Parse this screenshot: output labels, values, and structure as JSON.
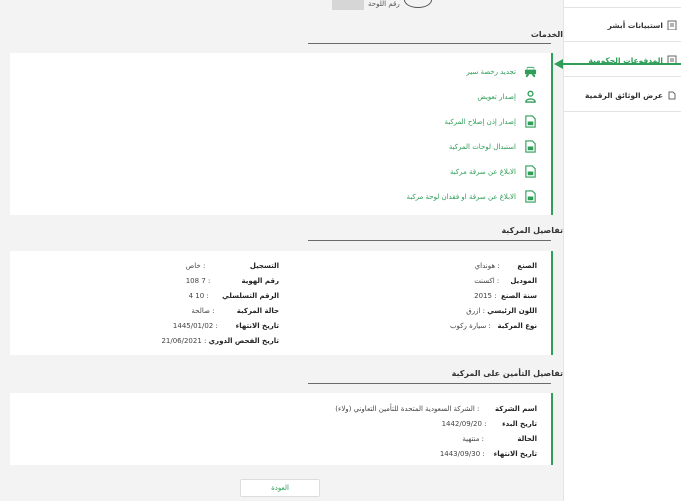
{
  "header": {
    "plate_label": "رقم اللوحة"
  },
  "services": {
    "title": "الخدمات",
    "items": [
      {
        "label": "تجديد رخصة سير",
        "icon": "car-icon"
      },
      {
        "label": "إصدار تعويض",
        "icon": "person-icon"
      },
      {
        "label": "إصدار إذن إصلاح المركبة",
        "icon": "document-icon"
      },
      {
        "label": "استبدال لوحات المركبة",
        "icon": "document-icon"
      },
      {
        "label": "الابلاغ عن سرقة مركبة",
        "icon": "document-icon"
      },
      {
        "label": "الابلاغ عن سرقة او فقدان لوحة مركبة",
        "icon": "document-icon"
      }
    ]
  },
  "vehicle": {
    "title": "تفاصيل المركبة",
    "right": [
      {
        "k": "الصنع",
        "v": ": هونداي"
      },
      {
        "k": "الموديل",
        "v": ": اكسنت"
      },
      {
        "k": "سنة الصنع",
        "v": ": 2015"
      },
      {
        "k": "اللون الرئيسي",
        "v": ": ازرق"
      },
      {
        "k": "نوع المركبة",
        "v": ": سيارة ركوب"
      }
    ],
    "left": [
      {
        "k": "التسجيل",
        "v": ": خاص"
      },
      {
        "k": "رقم الهوية",
        "v": ": 7 108"
      },
      {
        "k": "الرقم التسلسلي",
        "v": ": 10 4"
      },
      {
        "k": "حالة المركبة",
        "v": ": صالحة"
      },
      {
        "k": "تاريخ الانتهاء",
        "v": ": 1445/01/02"
      },
      {
        "k": "تاريخ الفحص الدوري",
        "v": ": 21/06/2021"
      }
    ]
  },
  "insurance": {
    "title": "تفاصيل التأمين على المركبة",
    "rows": [
      {
        "k": "اسم الشركة",
        "v": ": الشركة السعودية المتحدة للتأمين التعاوني (ولاء)"
      },
      {
        "k": "تاريخ البدء",
        "v": ": 1442/09/20"
      },
      {
        "k": "الحالة",
        "v": ": منتهية"
      },
      {
        "k": "تاريخ الانتهاء",
        "v": ": 1443/09/30"
      }
    ]
  },
  "back_label": "العودة",
  "sidebar": {
    "items": [
      {
        "label": "استبيانات أبشر"
      },
      {
        "label": "المدفوعات الحكومية"
      },
      {
        "label": "عرض الوثائق الرقمية"
      }
    ]
  },
  "colors": {
    "accent": "#2e9e58"
  }
}
